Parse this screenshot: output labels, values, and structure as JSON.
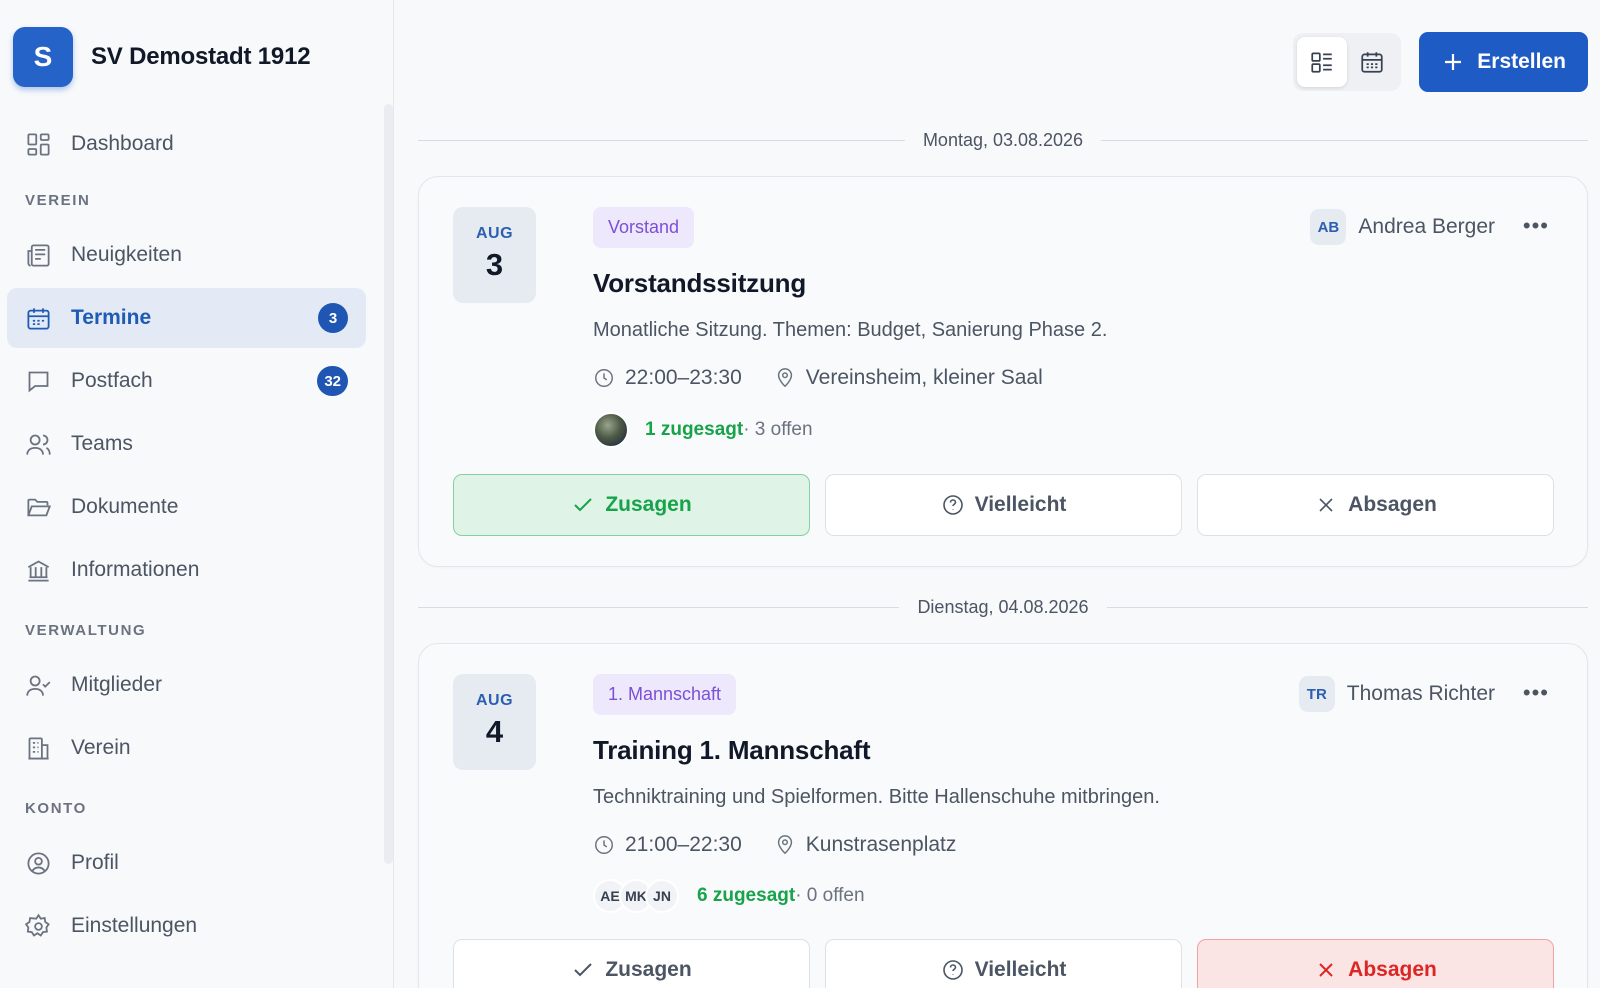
{
  "brand": {
    "initial": "S",
    "name": "SV Demostadt 1912"
  },
  "nav": {
    "dashboard": "Dashboard",
    "section_verein": "VEREIN",
    "neuigkeiten": "Neuigkeiten",
    "termine": "Termine",
    "termine_badge": "3",
    "postfach": "Postfach",
    "postfach_badge": "32",
    "teams": "Teams",
    "dokumente": "Dokumente",
    "informationen": "Informationen",
    "section_verwaltung": "VERWALTUNG",
    "mitglieder": "Mitglieder",
    "verein": "Verein",
    "section_konto": "KONTO",
    "profil": "Profil",
    "einstellungen": "Einstellungen"
  },
  "toolbar": {
    "create_label": "Erstellen"
  },
  "events": [
    {
      "date_heading": "Montag, 03.08.2026",
      "month": "AUG",
      "day": "3",
      "tag": "Vorstand",
      "title": "Vorstandssitzung",
      "description": "Monatliche Sitzung. Themen: Budget, Sanierung Phase 2.",
      "time": "22:00–23:30",
      "location": "Vereinsheim, kleiner Saal",
      "accepted": "1 zugesagt",
      "open": " · 3 offen",
      "owner_initials": "AB",
      "owner_name": "Andrea Berger",
      "response": "accepted"
    },
    {
      "date_heading": "Dienstag, 04.08.2026",
      "month": "AUG",
      "day": "4",
      "tag": "1. Mannschaft",
      "title": "Training 1. Mannschaft",
      "description": "Techniktraining und Spielformen. Bitte Hallenschuhe mitbringen.",
      "time": "21:00–22:30",
      "location": "Kunstrasenplatz",
      "attendee_initials": [
        "AE",
        "MK",
        "JN"
      ],
      "accepted": "6 zugesagt",
      "open": " · 0 offen",
      "owner_initials": "TR",
      "owner_name": "Thomas Richter",
      "response": "declined"
    }
  ],
  "actions": {
    "yes": "Zusagen",
    "maybe": "Vielleicht",
    "no": "Absagen"
  },
  "colors": {
    "primary": "#1f5bc5",
    "accent_green": "#16a34a",
    "accent_red": "#dc2626",
    "tag_purple": "#7c4fd6"
  }
}
